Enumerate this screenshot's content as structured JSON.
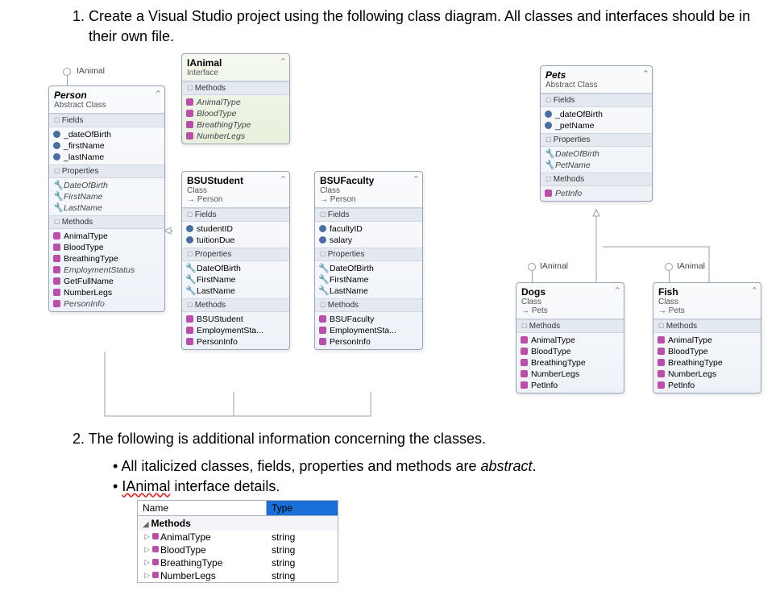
{
  "q1_text": "1.  Create a Visual Studio project using the following class diagram. All classes and interfaces should be in their own file.",
  "q2_text": "2.  The following is additional information concerning the classes.",
  "bullet1_pre": "All italicized classes, fields, properties and methods are ",
  "bullet1_it": "abstract",
  "bullet1_post": ".",
  "bullet2_a": "IAnimal",
  "bullet2_b": " interface details.",
  "boxes": {
    "ianimal": {
      "title": "IAnimal",
      "stereo": "Interface",
      "section": "Methods",
      "members": [
        {
          "n": "AnimalType",
          "t": "method",
          "it": true
        },
        {
          "n": "BloodType",
          "t": "method",
          "it": true
        },
        {
          "n": "BreathingType",
          "t": "method",
          "it": true
        },
        {
          "n": "NumberLegs",
          "t": "method",
          "it": true
        }
      ]
    },
    "person": {
      "title": "Person",
      "titleItalic": true,
      "stereo": "Abstract Class",
      "sections": [
        {
          "hdr": "Fields",
          "members": [
            {
              "n": "_dateOfBirth",
              "t": "field"
            },
            {
              "n": "_firstName",
              "t": "field"
            },
            {
              "n": "_lastName",
              "t": "field"
            }
          ]
        },
        {
          "hdr": "Properties",
          "members": [
            {
              "n": "DateOfBirth",
              "t": "prop",
              "it": true
            },
            {
              "n": "FirstName",
              "t": "prop",
              "it": true
            },
            {
              "n": "LastName",
              "t": "prop",
              "it": true
            }
          ]
        },
        {
          "hdr": "Methods",
          "members": [
            {
              "n": "AnimalType",
              "t": "method"
            },
            {
              "n": "BloodType",
              "t": "method"
            },
            {
              "n": "BreathingType",
              "t": "method"
            },
            {
              "n": "EmploymentStatus",
              "t": "method",
              "it": true
            },
            {
              "n": "GetFullName",
              "t": "method"
            },
            {
              "n": "NumberLegs",
              "t": "method"
            },
            {
              "n": "PersonInfo",
              "t": "method",
              "it": true
            }
          ]
        }
      ]
    },
    "bsustudent": {
      "title": "BSUStudent",
      "stereo": "Class",
      "inherit": "→ Person",
      "sections": [
        {
          "hdr": "Fields",
          "members": [
            {
              "n": "studentID",
              "t": "field"
            },
            {
              "n": "tuitionDue",
              "t": "field"
            }
          ]
        },
        {
          "hdr": "Properties",
          "members": [
            {
              "n": "DateOfBirth",
              "t": "prop"
            },
            {
              "n": "FirstName",
              "t": "prop"
            },
            {
              "n": "LastName",
              "t": "prop"
            }
          ]
        },
        {
          "hdr": "Methods",
          "members": [
            {
              "n": "BSUStudent",
              "t": "method"
            },
            {
              "n": "EmploymentSta...",
              "t": "method"
            },
            {
              "n": "PersonInfo",
              "t": "method"
            }
          ]
        }
      ]
    },
    "bsufaculty": {
      "title": "BSUFaculty",
      "stereo": "Class",
      "inherit": "→ Person",
      "sections": [
        {
          "hdr": "Fields",
          "members": [
            {
              "n": "facultyID",
              "t": "field"
            },
            {
              "n": "salary",
              "t": "field"
            }
          ]
        },
        {
          "hdr": "Properties",
          "members": [
            {
              "n": "DateOfBirth",
              "t": "prop"
            },
            {
              "n": "FirstName",
              "t": "prop"
            },
            {
              "n": "LastName",
              "t": "prop"
            }
          ]
        },
        {
          "hdr": "Methods",
          "members": [
            {
              "n": "BSUFaculty",
              "t": "method"
            },
            {
              "n": "EmploymentSta...",
              "t": "method"
            },
            {
              "n": "PersonInfo",
              "t": "method"
            }
          ]
        }
      ]
    },
    "pets": {
      "title": "Pets",
      "titleItalic": true,
      "stereo": "Abstract Class",
      "sections": [
        {
          "hdr": "Fields",
          "members": [
            {
              "n": "_dateOfBirth",
              "t": "field"
            },
            {
              "n": "_petName",
              "t": "field"
            }
          ]
        },
        {
          "hdr": "Properties",
          "members": [
            {
              "n": "DateOfBirth",
              "t": "prop",
              "it": true
            },
            {
              "n": "PetName",
              "t": "prop",
              "it": true
            }
          ]
        },
        {
          "hdr": "Methods",
          "members": [
            {
              "n": "PetInfo",
              "t": "method",
              "it": true
            }
          ]
        }
      ]
    },
    "dogs": {
      "title": "Dogs",
      "stereo": "Class",
      "inherit": "→ Pets",
      "sections": [
        {
          "hdr": "Methods",
          "members": [
            {
              "n": "AnimalType",
              "t": "method"
            },
            {
              "n": "BloodType",
              "t": "method"
            },
            {
              "n": "BreathingType",
              "t": "method"
            },
            {
              "n": "NumberLegs",
              "t": "method"
            },
            {
              "n": "PetInfo",
              "t": "method"
            }
          ]
        }
      ]
    },
    "fish": {
      "title": "Fish",
      "stereo": "Class",
      "inherit": "→ Pets",
      "sections": [
        {
          "hdr": "Methods",
          "members": [
            {
              "n": "AnimalType",
              "t": "method"
            },
            {
              "n": "BloodType",
              "t": "method"
            },
            {
              "n": "BreathingType",
              "t": "method"
            },
            {
              "n": "NumberLegs",
              "t": "method"
            },
            {
              "n": "PetInfo",
              "t": "method"
            }
          ]
        }
      ]
    }
  },
  "lollipops": {
    "person": "IAnimal",
    "dogs": "IAnimal",
    "fish": "IAnimal"
  },
  "detail_table": {
    "header_name": "Name",
    "header_type": "Type",
    "group": "Methods",
    "rows": [
      {
        "n": "AnimalType",
        "t": "string"
      },
      {
        "n": "BloodType",
        "t": "string"
      },
      {
        "n": "BreathingType",
        "t": "string"
      },
      {
        "n": "NumberLegs",
        "t": "string"
      }
    ]
  }
}
